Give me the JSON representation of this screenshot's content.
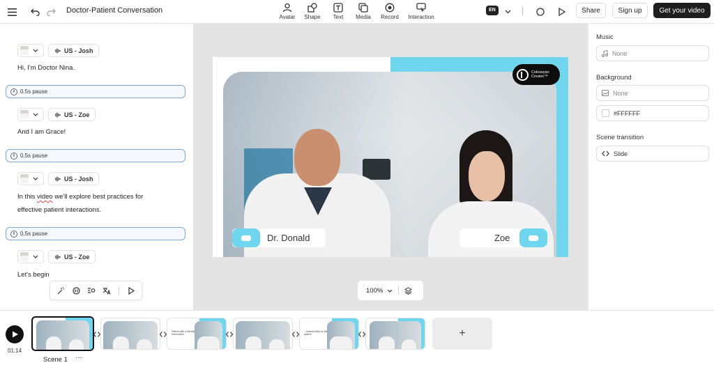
{
  "header": {
    "title": "Doctor-Patient Conversation",
    "tools": [
      {
        "label": "Avatar",
        "icon": "avatar-icon"
      },
      {
        "label": "Shape",
        "icon": "shape-icon"
      },
      {
        "label": "Text",
        "icon": "text-icon"
      },
      {
        "label": "Media",
        "icon": "media-icon"
      },
      {
        "label": "Record",
        "icon": "record-icon"
      },
      {
        "label": "Interaction",
        "icon": "interaction-icon"
      }
    ],
    "language": "EN",
    "share_label": "Share",
    "signup_label": "Sign up",
    "cta_label": "Get your video"
  },
  "script": {
    "speakers": [
      {
        "voice": "US - Josh"
      },
      {
        "voice": "US - Zoe"
      },
      {
        "voice": "US - Josh"
      },
      {
        "voice": "US - Zoe"
      }
    ],
    "lines": [
      "Hi, I'm Doctor Nina.",
      "And I am Grace!",
      "effective patient interactions.",
      "Let's begin"
    ],
    "line3": {
      "prefix": "In this ",
      "misspelled": "video",
      "suffix": " we'll explore best practices for"
    },
    "pause_label": "0.5s pause"
  },
  "canvas": {
    "brand_line1": "Colossyan",
    "brand_line2": "Creator™",
    "name_left": "Dr. Donald",
    "name_right": "Zoe",
    "zoom": "100%"
  },
  "panel": {
    "music_title": "Music",
    "music_value": "None",
    "background_title": "Background",
    "background_value": "None",
    "background_color": "#FFFFFF",
    "transition_title": "Scene transition",
    "transition_value": "Slide"
  },
  "timeline": {
    "time": "01:14",
    "scene_label": "Scene 1",
    "more": "···",
    "add": "+",
    "thumb_text": "Patient with a friendly introduction",
    "thumb_text2": "...actively listen to the patient"
  },
  "colors": {
    "accent": "#6fd6ee",
    "dark": "#1e1e1e",
    "pause_border": "#7ea7d8"
  }
}
